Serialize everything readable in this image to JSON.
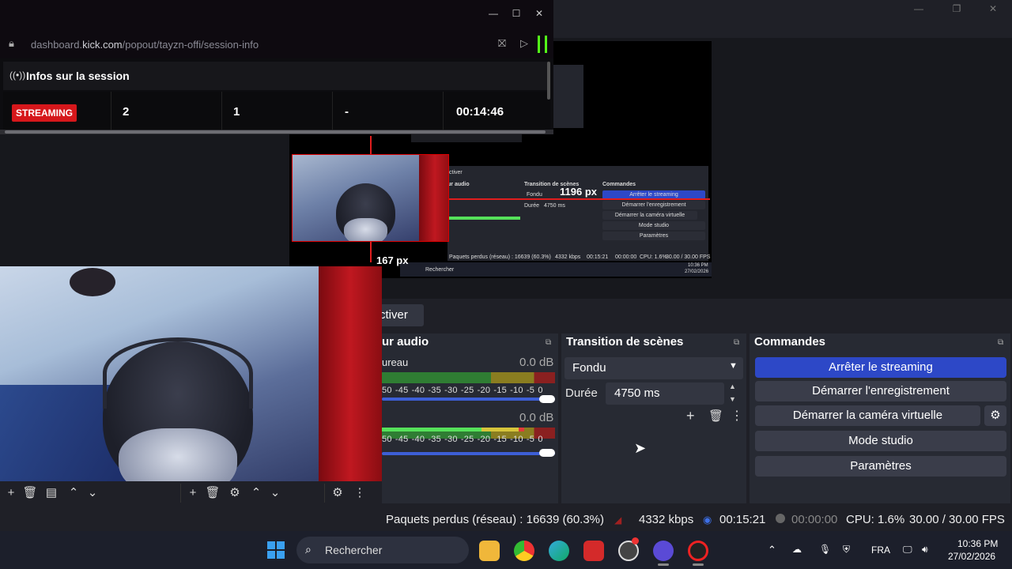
{
  "kick_popout": {
    "url_prefix": "dashboard.",
    "url_domain": "kick.com",
    "url_path": "/popout/tayzn-offi/session-info",
    "session_title": "Infos sur la session",
    "status_badge": "STREAMING",
    "stats": [
      "2",
      "1",
      "-",
      "00:14:46"
    ]
  },
  "preview": {
    "width_label": "1196 px",
    "height_label": "167 px"
  },
  "inner_preview": {
    "tab": "ctiver",
    "audio_title": "ur audio",
    "transition_title": "Transition de scènes",
    "fondu": "Fondu",
    "duree": "Durée",
    "duree_val": "4750 ms",
    "commands_title": "Commandes",
    "cmd": [
      "Arrêter le streaming",
      "Démarrer l'enregistrement",
      "Démarrer la caméra virtuelle",
      "Mode studio",
      "Paramètres"
    ],
    "status": "Paquets perdus (réseau) : 16639 (60.3%)",
    "kbps": "4332 kbps",
    "time": "00:15:21",
    "rec": "00:00:00",
    "cpu": "CPU: 1.6%",
    "fps": "30.00 / 30.00 FPS",
    "search": "Rechercher",
    "clock_time": "10:36 PM",
    "clock_date": "27/02/2026"
  },
  "activate_tab": "ctiver",
  "audio_mixer": {
    "title": "ur audio",
    "channels": [
      {
        "name": "ureau",
        "db": "0.0 dB"
      },
      {
        "name": "",
        "db": "0.0 dB"
      }
    ],
    "scale": "50 -45 -40 -35 -30 -25 -20 -15 -10 -5 0"
  },
  "transition": {
    "title": "Transition de scènes",
    "selected": "Fondu",
    "duration_label": "Durée",
    "duration_value": "4750 ms"
  },
  "commands": {
    "title": "Commandes",
    "stop_streaming": "Arrêter le streaming",
    "start_recording": "Démarrer l'enregistrement",
    "start_virtualcam": "Démarrer la caméra virtuelle",
    "studio_mode": "Mode studio",
    "settings": "Paramètres"
  },
  "status_bar": {
    "dropped": "Paquets perdus (réseau) : 16639 (60.3%)",
    "bitrate": "4332 kbps",
    "stream_time": "00:15:21",
    "rec_time": "00:00:00",
    "cpu": "CPU: 1.6%",
    "fps": "30.00 / 30.00 FPS"
  },
  "taskbar": {
    "search_placeholder": "Rechercher",
    "language": "FRA",
    "time": "10:36 PM",
    "date": "27/02/2026"
  }
}
